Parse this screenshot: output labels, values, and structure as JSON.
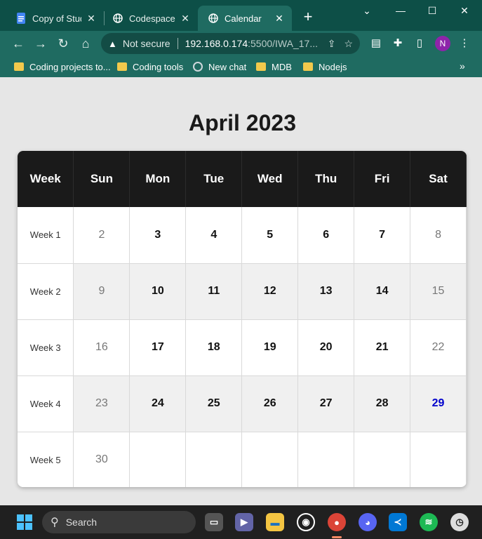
{
  "browser": {
    "tabs": [
      {
        "title": "Copy of Stude",
        "icon": "docs-icon"
      },
      {
        "title": "Codespace Lis",
        "icon": "globe-icon"
      },
      {
        "title": "Calendar",
        "icon": "globe-icon",
        "active": true
      }
    ],
    "new_tab_label": "+",
    "address": {
      "security_label": "Not secure",
      "host": "192.168.0.174",
      "path": ":5500/IWA_17..."
    },
    "profile_initial": "N",
    "bookmarks": [
      {
        "label": "Coding projects to...",
        "icon": "folder-icon"
      },
      {
        "label": "Coding tools",
        "icon": "folder-icon"
      },
      {
        "label": "New chat",
        "icon": "openai-icon"
      },
      {
        "label": "MDB",
        "icon": "folder-icon"
      },
      {
        "label": "Nodejs",
        "icon": "folder-icon"
      }
    ],
    "more_label": "»"
  },
  "page": {
    "title": "April 2023",
    "header": [
      "Week",
      "Sun",
      "Mon",
      "Tue",
      "Wed",
      "Thu",
      "Fri",
      "Sat"
    ],
    "weeks": [
      {
        "label": "Week 1",
        "days": [
          "2",
          "3",
          "4",
          "5",
          "6",
          "7",
          "8"
        ]
      },
      {
        "label": "Week 2",
        "days": [
          "9",
          "10",
          "11",
          "12",
          "13",
          "14",
          "15"
        ]
      },
      {
        "label": "Week 3",
        "days": [
          "16",
          "17",
          "18",
          "19",
          "20",
          "21",
          "22"
        ]
      },
      {
        "label": "Week 4",
        "days": [
          "23",
          "24",
          "25",
          "26",
          "27",
          "28",
          "29"
        ]
      },
      {
        "label": "Week 5",
        "days": [
          "30",
          "",
          "",
          "",
          "",
          "",
          ""
        ]
      }
    ],
    "today": "29",
    "today_color": "#0000cc"
  },
  "taskbar": {
    "search_label": "Search",
    "apps": [
      "task-view-icon",
      "teams-icon",
      "file-explorer-icon",
      "github-icon",
      "chrome-icon",
      "discord-icon",
      "vscode-icon",
      "spotify-icon",
      "clock-icon"
    ]
  }
}
